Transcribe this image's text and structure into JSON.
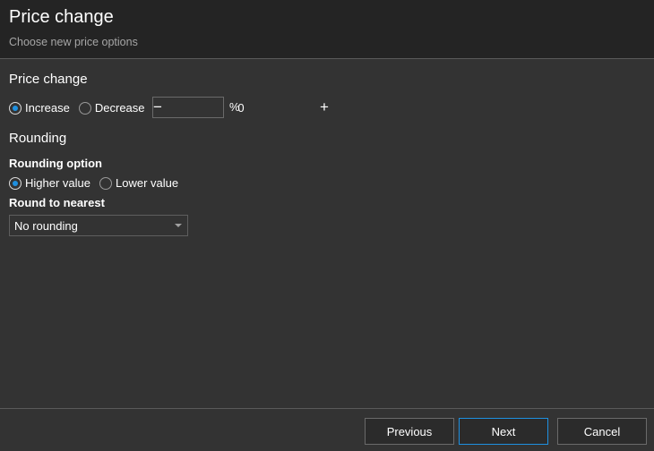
{
  "header": {
    "title": "Price change",
    "subtitle": "Choose new price options"
  },
  "price_change": {
    "section_title": "Price change",
    "direction": {
      "options": [
        {
          "label": "Increase",
          "checked": true
        },
        {
          "label": "Decrease",
          "checked": false
        }
      ]
    },
    "stepper": {
      "minus_glyph": "−",
      "plus_glyph": "+",
      "value": "0"
    },
    "unit": "%"
  },
  "rounding": {
    "section_title": "Rounding",
    "option_label": "Rounding option",
    "options": [
      {
        "label": "Higher value",
        "checked": true
      },
      {
        "label": "Lower value",
        "checked": false
      }
    ],
    "nearest_label": "Round to nearest",
    "nearest_selected": "No rounding"
  },
  "footer": {
    "previous_label": "Previous",
    "next_label": "Next",
    "cancel_label": "Cancel"
  },
  "colors": {
    "accent": "#1e90e0",
    "background": "#333333",
    "header_background": "#242424"
  }
}
